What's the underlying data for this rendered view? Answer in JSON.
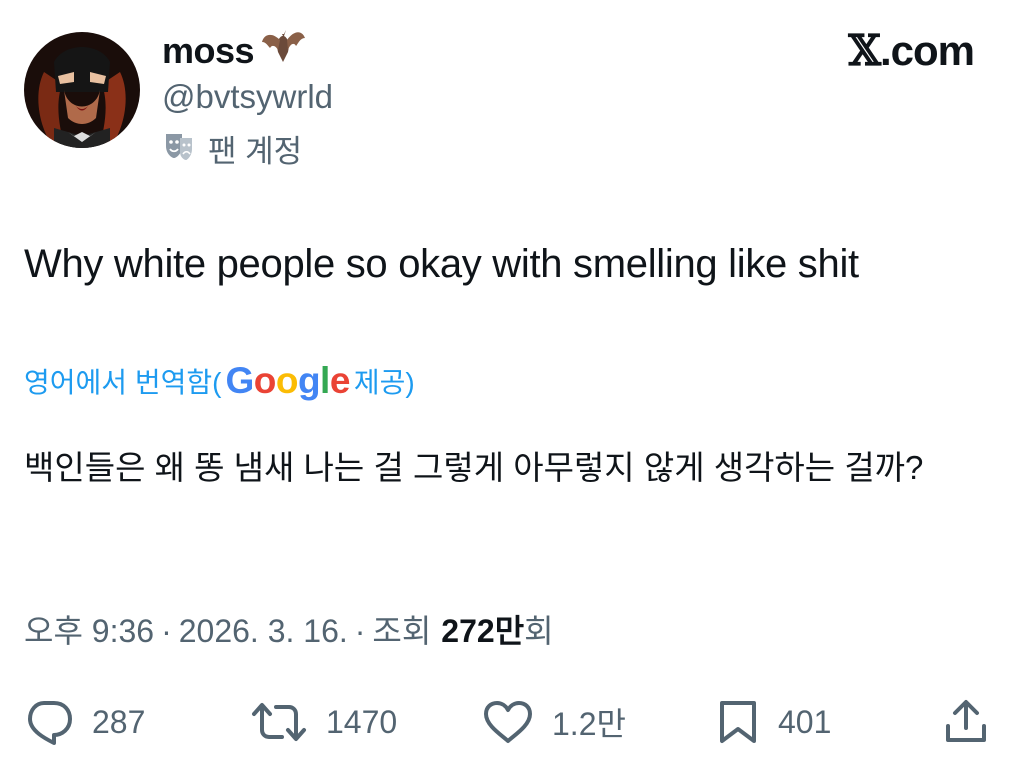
{
  "user": {
    "display_name": "moss",
    "handle": "@bvtsywrld",
    "account_label": "팬 계정"
  },
  "brand": {
    "x": "𝕏",
    "suffix": ".com"
  },
  "tweet": {
    "text": "Why white people so okay with smelling like shit",
    "translate_prefix": "영어에서 번역함(",
    "translate_suffix": "제공)",
    "google": [
      "G",
      "o",
      "o",
      "g",
      "l",
      "e"
    ],
    "translated_text": "백인들은 왜 똥 냄새 나는 걸 그렇게 아무렇지 않게 생각하는 걸까?"
  },
  "meta": {
    "time": "오후 9:36",
    "date": "2026. 3. 16.",
    "views_label": "조회",
    "views_count": "272만",
    "views_suffix": "회"
  },
  "actions": {
    "replies": "287",
    "reposts": "1470",
    "likes": "1.2만",
    "bookmarks": "401"
  },
  "colors": {
    "link": "#1d9bf0",
    "secondary_text": "#536471",
    "primary_text": "#0f1419"
  }
}
